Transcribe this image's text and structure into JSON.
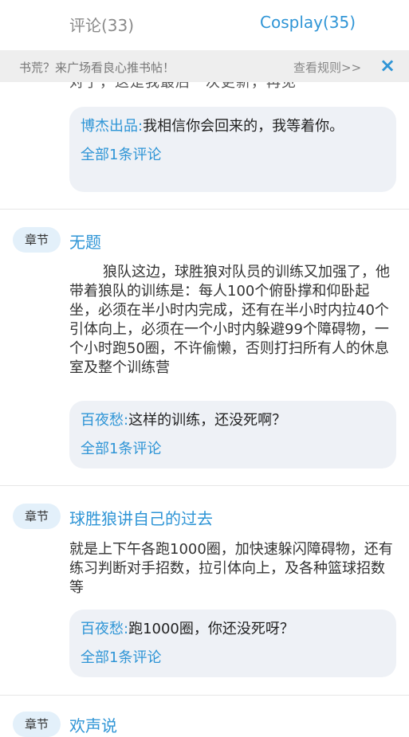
{
  "tabs": {
    "comments": "评论(33)",
    "cosplay": "Cosplay(35)"
  },
  "notice": {
    "text": "书荒？来广场看良心推书帖！",
    "rule": "查看规则>>",
    "close_icon": "×"
  },
  "partial_text": "对了，这是我最后一次更新，再见",
  "posts": [
    {
      "comment": {
        "user": "博杰出品:",
        "text": "我相信你会回来的，我等着你。"
      },
      "more": "全部1条评论"
    },
    {
      "tag": "章节",
      "title": "无题",
      "body": "狼队这边，球胜狼对队员的训练又加强了，他带着狼队的训练是：每人100个俯卧撑和仰卧起坐，必须在半小时内完成，还有在半小时内拉40个引体向上，必须在一个小时内躲避99个障碍物，一个小时跑50圈，不许偷懒，否则打扫所有人的休息室及整个训练营",
      "comment": {
        "user": "百夜愁:",
        "text": "这样的训练，还没死啊？"
      },
      "more": "全部1条评论"
    },
    {
      "tag": "章节",
      "title": "球胜狼讲自己的过去",
      "body": "就是上下午各跑1000圈，加快速躲闪障碍物，还有练习判断对手招数，拉引体向上，及各种篮球招数等",
      "comment": {
        "user": "百夜愁:",
        "text": "跑1000圈，你还没死呀？"
      },
      "more": "全部1条评论"
    },
    {
      "tag": "章节",
      "title": "欢声说"
    }
  ]
}
